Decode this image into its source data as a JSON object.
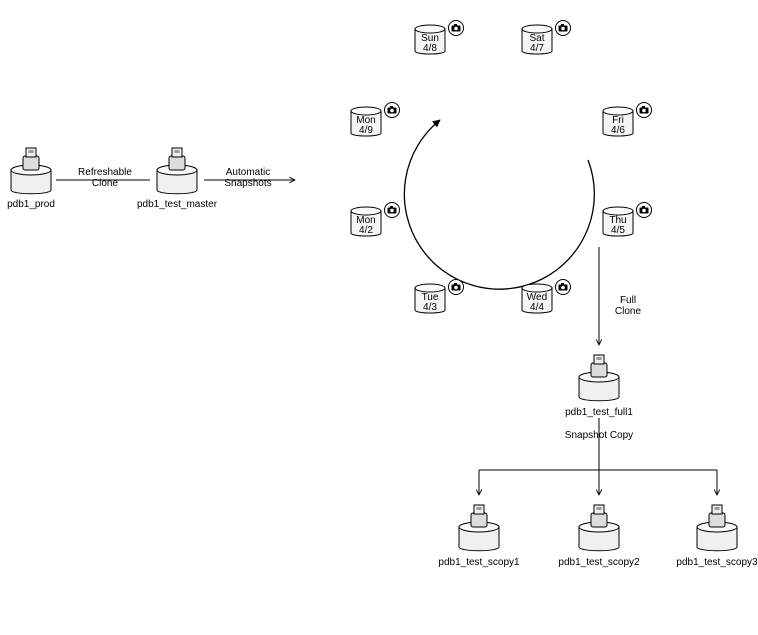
{
  "prod": {
    "label": "pdb1_prod"
  },
  "master": {
    "label": "pdb1_test_master"
  },
  "flow": {
    "refreshable": "Refreshable\nClone",
    "automatic": "Automatic\nSnapshots",
    "fullclone": "Full\nClone",
    "snapshotcopy": "Snapshot Copy"
  },
  "snapshots": [
    {
      "day": "Sun",
      "date": "4/8"
    },
    {
      "day": "Sat",
      "date": "4/7"
    },
    {
      "day": "Mon",
      "date": "4/9"
    },
    {
      "day": "Fri",
      "date": "4/6"
    },
    {
      "day": "Mon",
      "date": "4/2"
    },
    {
      "day": "Thu",
      "date": "4/5"
    },
    {
      "day": "Tue",
      "date": "4/3"
    },
    {
      "day": "Wed",
      "date": "4/4"
    }
  ],
  "full": {
    "label": "pdb1_test_full1"
  },
  "copies": [
    {
      "label": "pdb1_test_scopy1"
    },
    {
      "label": "pdb1_test_scopy2"
    },
    {
      "label": "pdb1_test_scopy3"
    }
  ]
}
